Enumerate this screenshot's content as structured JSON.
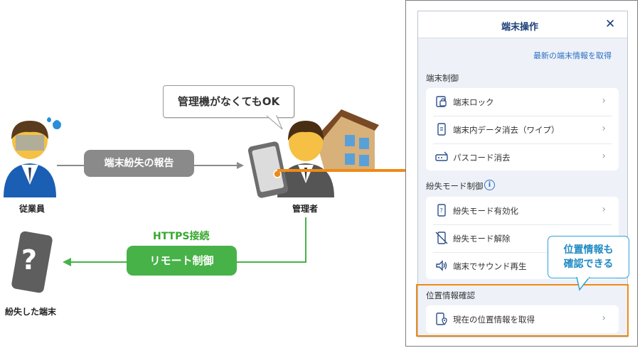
{
  "diagram": {
    "employee_label": "従業員",
    "admin_label": "管理者",
    "lost_device_label": "紛失した端末",
    "report_label": "端末紛失の報告",
    "speech_text": "管理機がなくてもOK",
    "https_label": "HTTPS接続",
    "remote_label": "リモート制御",
    "question_mark": "?"
  },
  "panel": {
    "title": "端末操作",
    "close_glyph": "✕",
    "refresh_link": "最新の端末情報を取得",
    "sections": [
      {
        "heading": "端末制御",
        "items": [
          {
            "label": "端末ロック",
            "icon": "lock-icon"
          },
          {
            "label": "端末内データ消去（ワイプ）",
            "icon": "wipe-icon"
          },
          {
            "label": "パスコード消去",
            "icon": "passcode-icon"
          }
        ]
      },
      {
        "heading": "紛失モード制御",
        "items": [
          {
            "label": "紛失モード有効化",
            "icon": "lost-mode-icon"
          },
          {
            "label": "紛失モード解除",
            "icon": "lost-mode-off-icon"
          },
          {
            "label": "端末でサウンド再生",
            "icon": "sound-icon"
          }
        ]
      },
      {
        "heading": "位置情報確認",
        "items": [
          {
            "label": "現在の位置情報を取得",
            "icon": "location-icon"
          }
        ]
      }
    ],
    "chevron": "›",
    "info_glyph": "i",
    "callout_line1": "位置情報も",
    "callout_line2": "確認できる"
  },
  "colors": {
    "accent_orange": "#ef8a16",
    "accent_blue": "#2d6fc4",
    "green": "#47b248",
    "grey": "#8a8a8a"
  }
}
